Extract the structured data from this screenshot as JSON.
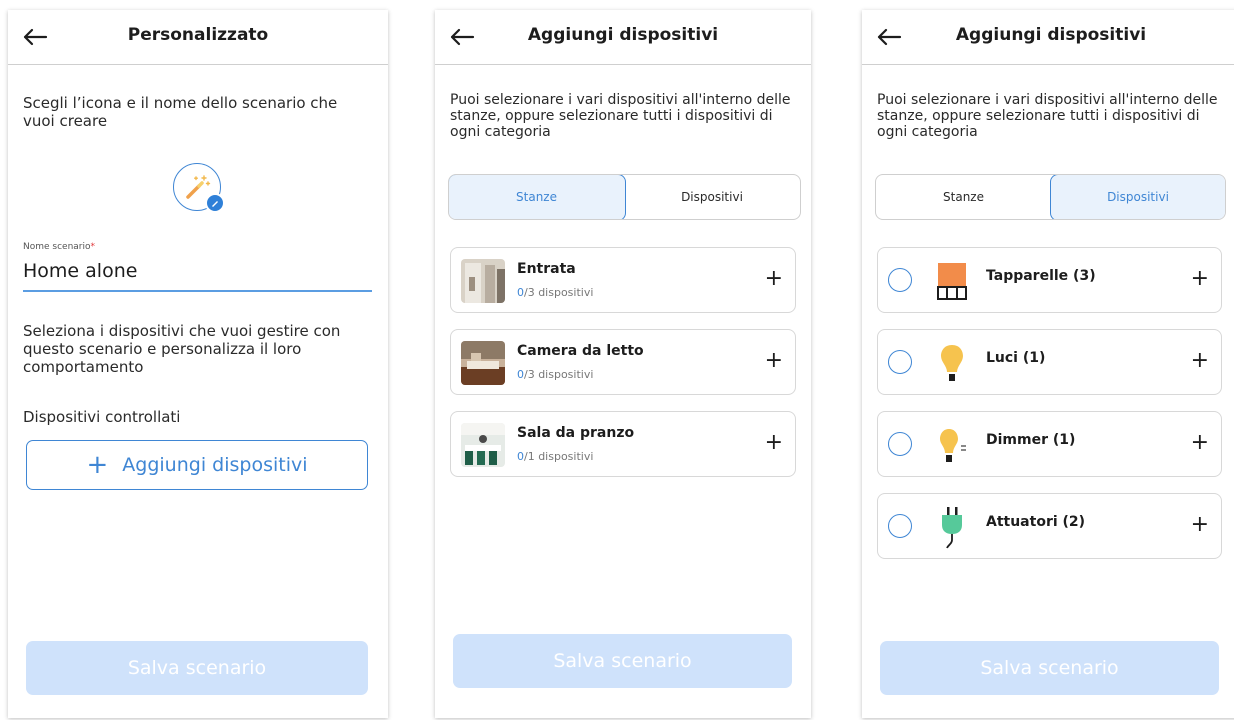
{
  "screen1": {
    "title": "Personalizzato",
    "intro": "Scegli l’icona e il nome dello scenario che vuoi creare",
    "scene_icon": "magic-wand-icon",
    "name_label": "Nome scenario",
    "name_required_mark": "*",
    "name_value": "Home alone",
    "select_text": "Seleziona i dispositivi che vuoi gestire con questo scenario e personalizza il loro comportamento",
    "controlled_label": "Dispositivi controllati",
    "add_button": {
      "icon": "+",
      "label": "Aggiungi dispositivi"
    },
    "save_button": "Salva scenario"
  },
  "screen2": {
    "title": "Aggiungi dispositivi",
    "intro": "Puoi selezionare i vari dispositivi all'interno delle stanze, oppure selezionare tutti i dispositivi di ogni categoria",
    "tabs": [
      {
        "label": "Stanze",
        "active": true
      },
      {
        "label": "Dispositivi",
        "active": false
      }
    ],
    "rooms": [
      {
        "name": "Entrata",
        "selected": "0",
        "rest": "/3 dispositivi",
        "image": "entrance-photo"
      },
      {
        "name": "Camera da letto",
        "selected": "0",
        "rest": "/3 dispositivi",
        "image": "bedroom-photo"
      },
      {
        "name": "Sala da pranzo",
        "selected": "0",
        "rest": "/1 dispositivi",
        "image": "dining-room-photo"
      }
    ],
    "add_symbol": "+",
    "save_button": "Salva scenario"
  },
  "screen3": {
    "title": "Aggiungi dispositivi",
    "intro": "Puoi selezionare i vari dispositivi all'interno delle stanze, oppure selezionare tutti i dispositivi di ogni categoria",
    "tabs": [
      {
        "label": "Stanze",
        "active": false
      },
      {
        "label": "Dispositivi",
        "active": true
      }
    ],
    "categories": [
      {
        "name": "Tapparelle (3)",
        "icon": "shutter-icon"
      },
      {
        "name": "Luci (1)",
        "icon": "light-bulb-icon"
      },
      {
        "name": "Dimmer (1)",
        "icon": "dimmer-bulb-icon"
      },
      {
        "name": "Attuatori (2)",
        "icon": "plug-icon"
      }
    ],
    "add_symbol": "+",
    "save_button": "Salva scenario"
  },
  "colors": {
    "accent": "#3f86d4",
    "save_disabled": "#cfe2fb",
    "tab_active_bg": "#e9f2fc",
    "shutter": "#f28c4a",
    "bulb": "#f6c34e",
    "plug": "#56c99a"
  }
}
